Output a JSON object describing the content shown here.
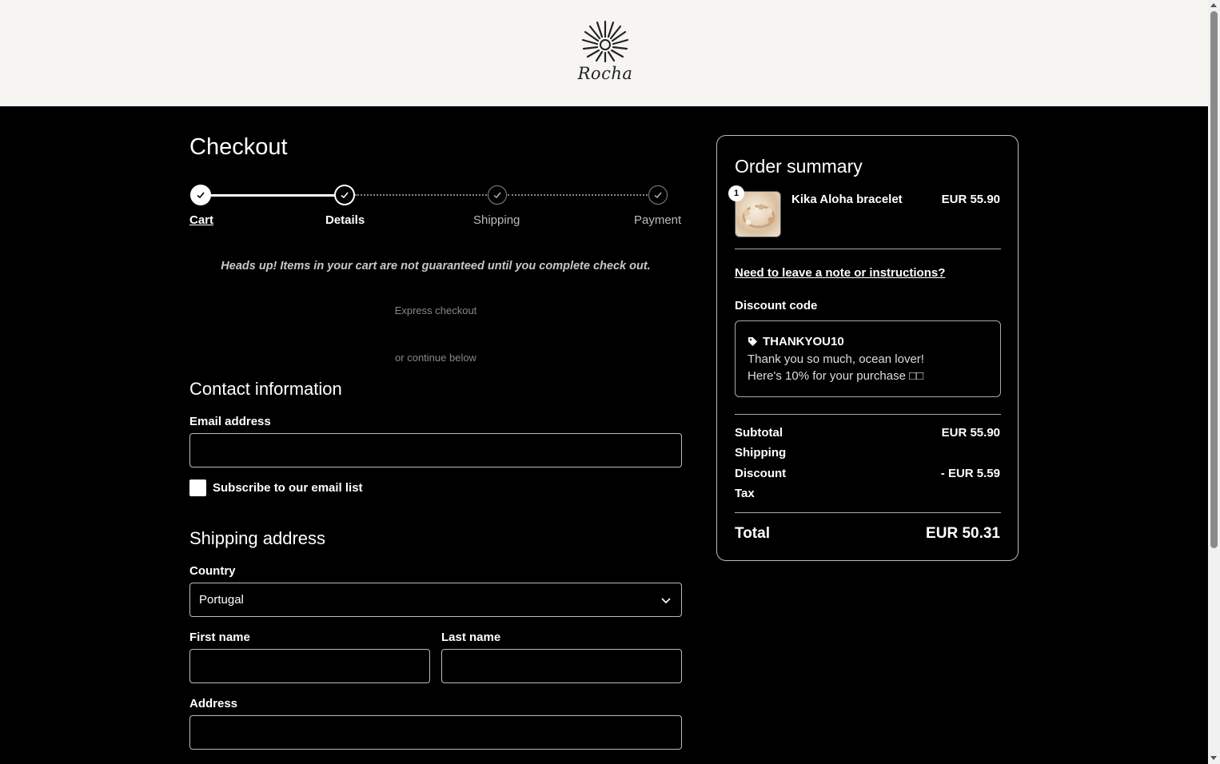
{
  "brand": {
    "name": "Rocha"
  },
  "checkout": {
    "title": "Checkout",
    "steps": [
      {
        "label": "Cart",
        "state": "done"
      },
      {
        "label": "Details",
        "state": "current"
      },
      {
        "label": "Shipping",
        "state": "todo"
      },
      {
        "label": "Payment",
        "state": "todo"
      }
    ],
    "notice": "Heads up! Items in your cart are not guaranteed until you complete check out.",
    "express_checkout": "Express checkout",
    "continue_below": "or continue below"
  },
  "contact": {
    "title": "Contact information",
    "email_label": "Email address",
    "email_value": "",
    "subscribe_label": "Subscribe to our email list",
    "subscribe_checked": false
  },
  "shipping": {
    "title": "Shipping address",
    "country_label": "Country",
    "country_value": "Portugal",
    "first_name_label": "First name",
    "last_name_label": "Last name",
    "address_label": "Address"
  },
  "summary": {
    "title": "Order summary",
    "item": {
      "quantity": "1",
      "name": "Kika Aloha bracelet",
      "price": "EUR 55.90"
    },
    "note_link": "Need to leave a note or instructions?",
    "discount_label": "Discount code",
    "discount": {
      "code": "THANKYOU10",
      "line1": "Thank you so much, ocean lover!",
      "line2": "Here's 10% for your purchase □□"
    },
    "rows": {
      "subtotal_label": "Subtotal",
      "subtotal_value": "EUR 55.90",
      "shipping_label": "Shipping",
      "shipping_value": "",
      "discount_label": "Discount",
      "discount_value": "- EUR 5.59",
      "tax_label": "Tax",
      "tax_value": ""
    },
    "total_label": "Total",
    "total_value": "EUR 50.31"
  },
  "icons": {
    "logo": "sun-burst-logo",
    "check": "check-icon",
    "tag": "tag-icon",
    "chevron": "chevron-down-icon"
  }
}
